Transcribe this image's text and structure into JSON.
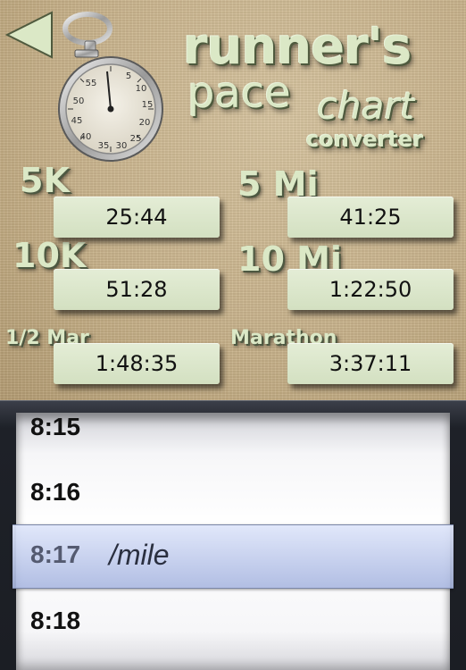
{
  "header": {
    "brand_line1": "runner's",
    "brand_line2": "pace",
    "brand_line3": "chart",
    "brand_line4": "converter"
  },
  "icons": {
    "back": "back-arrow-icon",
    "stopwatch": "stopwatch-icon"
  },
  "stopwatch_dial": {
    "numbers": [
      "5",
      "10",
      "15",
      "20",
      "25",
      "30",
      "35",
      "40",
      "45",
      "50",
      "55"
    ]
  },
  "results": [
    {
      "label": "5K",
      "value": "25:44"
    },
    {
      "label": "5 Mi",
      "value": "41:25"
    },
    {
      "label": "10K",
      "value": "51:28"
    },
    {
      "label": "10 Mi",
      "value": "1:22:50"
    },
    {
      "label": "1/2 Mar",
      "value": "1:48:35"
    },
    {
      "label": "Marathon",
      "value": "3:37:11"
    }
  ],
  "picker": {
    "rows": [
      "8:15",
      "8:16",
      "8:17",
      "8:18"
    ],
    "selected": "8:17",
    "unit": "/mile"
  },
  "colors": {
    "label_text": "#dbe8c6",
    "box_fill": "#dde8cc",
    "picker_band": "#b6c2e4"
  }
}
